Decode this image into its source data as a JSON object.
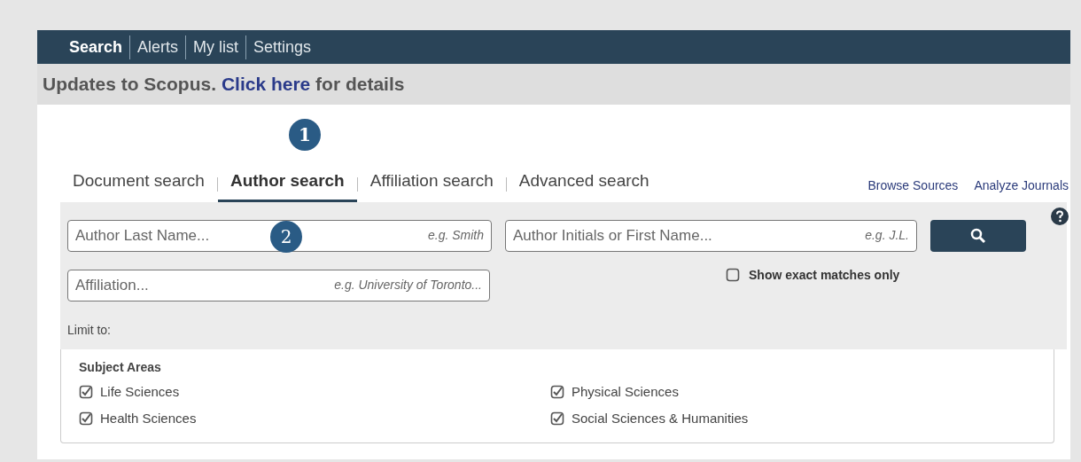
{
  "nav": [
    {
      "label": "Search",
      "selected": true
    },
    {
      "label": "Alerts",
      "selected": false
    },
    {
      "label": "My list",
      "selected": false
    },
    {
      "label": "Settings",
      "selected": false
    }
  ],
  "banner": {
    "text": "Updates to Scopus.",
    "link": "Click here",
    "rest": "for details"
  },
  "callouts": [
    "1",
    "2"
  ],
  "tabs": [
    {
      "label": "Document search",
      "selected": false
    },
    {
      "label": "Author search",
      "selected": true
    },
    {
      "label": "Affiliation search",
      "selected": false
    },
    {
      "label": "Advanced search",
      "selected": false
    }
  ],
  "links": [
    "Browse Sources",
    "Analyze Journals"
  ],
  "fields": [
    {
      "placeholder": "Author Last Name...",
      "hint": "e.g. Smith"
    },
    {
      "placeholder": "Author Initials or First Name...",
      "hint": "e.g. J.L."
    },
    {
      "placeholder": "Affiliation...",
      "hint": "e.g. University of Toronto..."
    }
  ],
  "exact_matches": {
    "label": "Show exact matches only",
    "checked": false
  },
  "limit_label": "Limit to:",
  "subject_areas": {
    "title": "Subject Areas",
    "items": [
      {
        "label": "Life Sciences",
        "checked": true
      },
      {
        "label": "Physical Sciences",
        "checked": true
      },
      {
        "label": "Health Sciences",
        "checked": true
      },
      {
        "label": "Social Sciences & Humanities",
        "checked": true
      }
    ]
  }
}
